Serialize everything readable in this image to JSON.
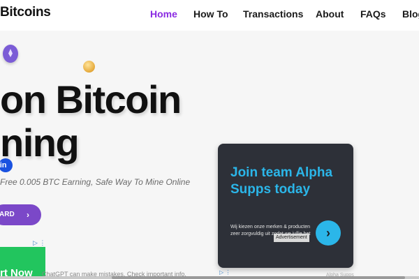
{
  "header": {
    "logo": "Bitcoins",
    "nav": [
      {
        "label": "Home",
        "active": true
      },
      {
        "label": "How To"
      },
      {
        "label": "Transactions"
      },
      {
        "label": "About"
      },
      {
        "label": "FAQs"
      },
      {
        "label": "Blog"
      }
    ]
  },
  "hero": {
    "title_line1": "on Bitcoin",
    "title_line2": "ning",
    "badge": "oin",
    "subtitle": "Free 0.005 BTC Earning, Safe Way To Mine Online",
    "cta_label": "ARD",
    "cta_chevron": "›"
  },
  "left_ad": {
    "button_text": "rt Now",
    "ad_marker": "▷ ⋮"
  },
  "notice": "ChatGPT can make mistakes. Check important info.",
  "side_ad": {
    "headline": "Join team Alpha Supps today",
    "body": "Wij kiezen onze merken & producten zeer zorgvuldig uit zodat we jullie het",
    "label": "Advertisement",
    "arrow": "›",
    "ad_marker": "▷ ⋮",
    "footer": "Alpha Supps"
  },
  "colors": {
    "nav_active": "#8a2be2",
    "cta": "#7b48c8",
    "badge": "#1a52e0",
    "ad_accent": "#2bb6e9",
    "ad_bg": "#2d3038",
    "green_ad": "#22c55e"
  },
  "icons": [
    "ethereum-coin-icon",
    "bitcoin-coin-icon",
    "chevron-right-icon",
    "adchoices-icon"
  ]
}
